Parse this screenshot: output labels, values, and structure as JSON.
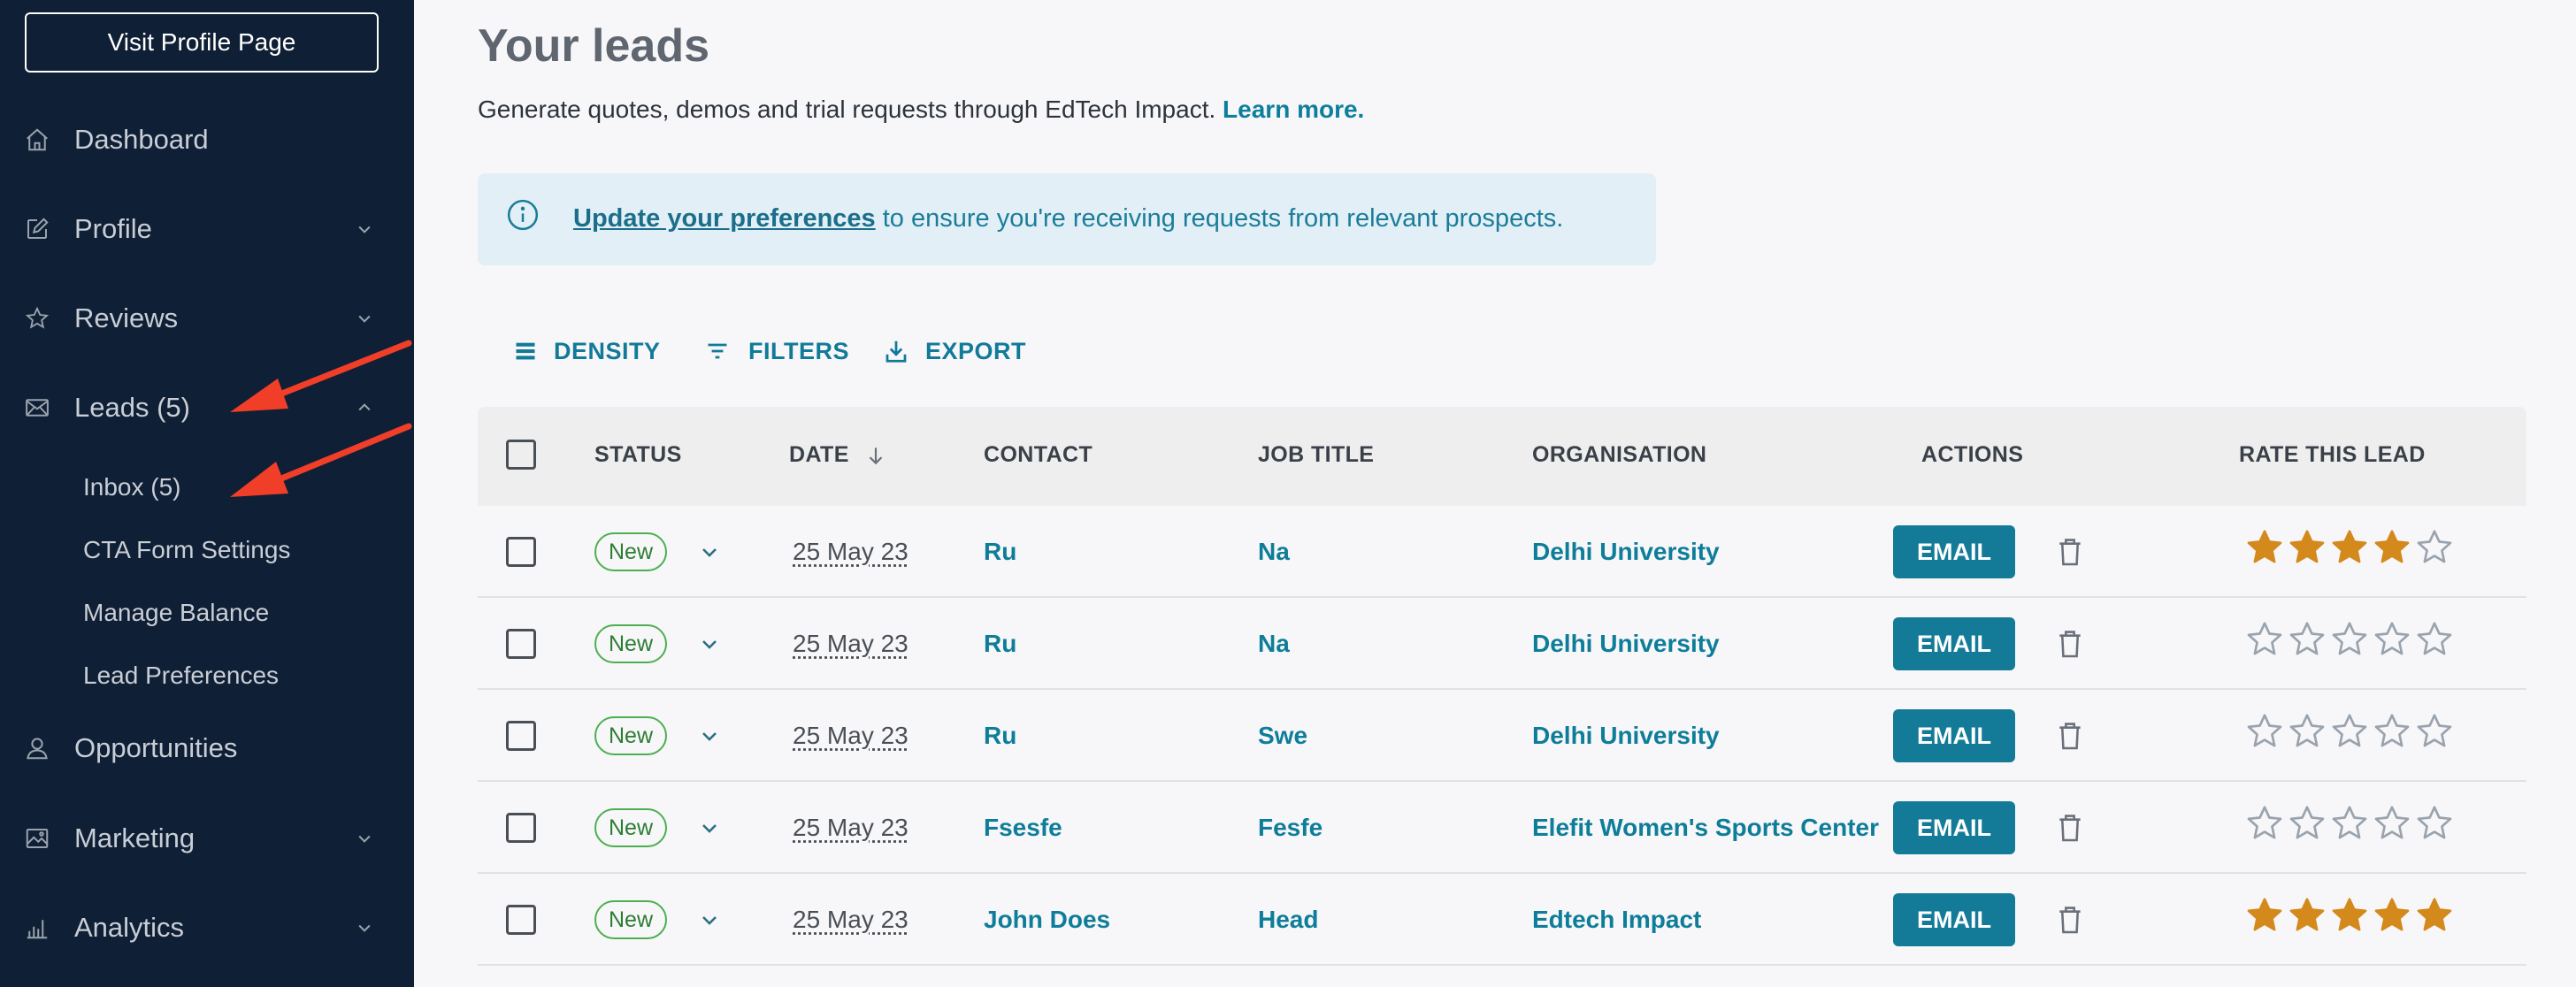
{
  "sidebar": {
    "visit_profile": "Visit Profile Page",
    "items": [
      {
        "label": "Dashboard",
        "icon": "home-icon"
      },
      {
        "label": "Profile",
        "icon": "edit-icon"
      },
      {
        "label": "Reviews",
        "icon": "star-icon"
      },
      {
        "label": "Leads (5)",
        "icon": "mail-icon"
      },
      {
        "label": "Opportunities",
        "icon": "user-icon"
      },
      {
        "label": "Marketing",
        "icon": "image-icon"
      },
      {
        "label": "Analytics",
        "icon": "bar-chart-icon"
      }
    ],
    "leads_subitems": [
      "Inbox (5)",
      "CTA Form Settings",
      "Manage Balance",
      "Lead Preferences"
    ]
  },
  "main": {
    "title": "Your leads",
    "description": "Generate quotes, demos and trial requests through EdTech Impact.",
    "learn_more": "Learn more.",
    "info": {
      "link": "Update your preferences",
      "text": " to ensure you're receiving requests from relevant prospects."
    },
    "toolbar": {
      "density": "DENSITY",
      "filters": "FILTERS",
      "export": "EXPORT"
    }
  },
  "table": {
    "headers": {
      "status": "STATUS",
      "date": "DATE",
      "contact": "CONTACT",
      "job_title": "JOB TITLE",
      "organisation": "ORGANISATION",
      "actions": "ACTIONS",
      "rate": "RATE THIS LEAD"
    },
    "email_label": "EMAIL",
    "rows": [
      {
        "status": "New",
        "date": "25 May 23",
        "contact": "Ru",
        "job_title": "Na",
        "organisation": "Delhi University",
        "rating": 4
      },
      {
        "status": "New",
        "date": "25 May 23",
        "contact": "Ru",
        "job_title": "Na",
        "organisation": "Delhi University",
        "rating": 0
      },
      {
        "status": "New",
        "date": "25 May 23",
        "contact": "Ru",
        "job_title": "Swe",
        "organisation": "Delhi University",
        "rating": 0
      },
      {
        "status": "New",
        "date": "25 May 23",
        "contact": "Fsesfe",
        "job_title": "Fesfe",
        "organisation": "Elefit Women's Sports Center",
        "rating": 0
      },
      {
        "status": "New",
        "date": "25 May 23",
        "contact": "John Does",
        "job_title": "Head",
        "organisation": "Edtech Impact",
        "rating": 5
      }
    ]
  },
  "colors": {
    "sidebar_bg": "#0f1f35",
    "accent": "#137b98",
    "star_filled": "#d4891c",
    "star_empty": "#9aa3ad",
    "annotation_arrow": "#f03e28"
  }
}
